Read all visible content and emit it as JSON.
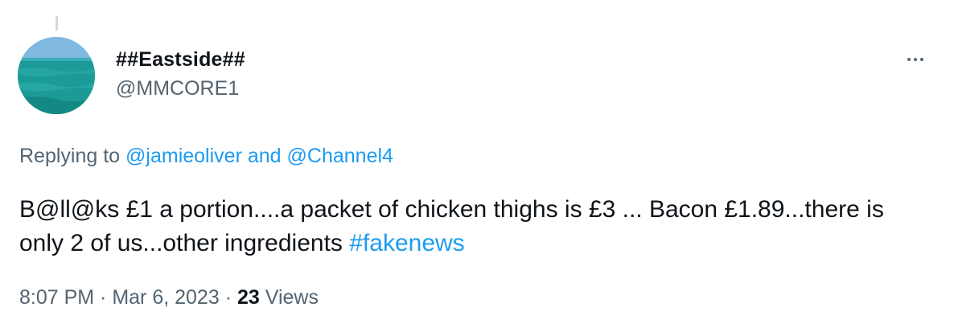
{
  "tweet": {
    "author": {
      "display_name": "##Eastside##",
      "handle": "@MMCORE1"
    },
    "reply": {
      "prefix": "Replying to ",
      "mention_1": "@jamieoliver",
      "joiner": " and ",
      "mention_2": "@Channel4"
    },
    "body": {
      "text": "B@ll@ks £1 a portion....a packet of chicken thighs is £3 ... Bacon £1.89...there is only 2 of us...other ingredients ",
      "hashtag": "#fakenews"
    },
    "meta": {
      "time": "8:07 PM",
      "separator_1": " · ",
      "date": "Mar 6, 2023",
      "separator_2": " · ",
      "views_count": "23",
      "views_label": " Views"
    }
  },
  "icons": {
    "more": "more-horizontal-icon"
  },
  "colors": {
    "text_primary": "#0f1419",
    "text_secondary": "#536471",
    "link": "#1d9bf0",
    "thread_line": "#cfd9de"
  }
}
